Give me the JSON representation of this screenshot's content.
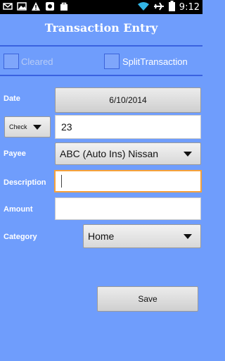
{
  "status_bar": {
    "time": "9:12",
    "left_icons": [
      "mail-icon",
      "image-icon",
      "warning-icon",
      "android-icon",
      "bag-icon"
    ],
    "right_icons": [
      "wifi-icon",
      "airplane-icon",
      "battery-icon"
    ]
  },
  "title": "Transaction Entry",
  "cleared": {
    "label": "Cleared",
    "checked": false,
    "enabled": false
  },
  "split": {
    "label": "SplitTransaction",
    "checked": false
  },
  "form": {
    "date_label": "Date",
    "date_value": "6/10/2014",
    "check_type_value": "Check",
    "check_number": "23",
    "payee_label": "Payee",
    "payee_value": "ABC (Auto Ins) Nissan",
    "description_label": "Description",
    "description_value": "",
    "amount_label": "Amount",
    "amount_value": "",
    "category_label": "Category",
    "category_value": "Home"
  },
  "save_label": "Save",
  "colors": {
    "background": "#6f9dfc",
    "rule": "#3a62e0",
    "focus": "#f6a13a"
  }
}
